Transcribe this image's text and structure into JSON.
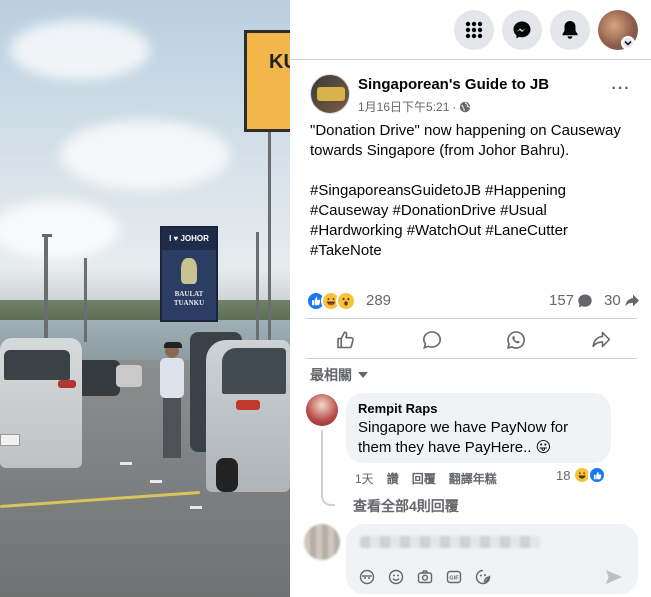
{
  "header": {
    "page_name": "Singaporean's Guide to JB",
    "timestamp": "1月16日下午5:21",
    "separator": "·",
    "more_label": "···"
  },
  "post": {
    "paragraph1": "\"Donation Drive\" now happening on Causeway towards Singapore (from Johor Bahru).",
    "paragraph2": "#SingaporeansGuidetoJB #Happening #Causeway #DonationDrive #Usual #Hardworking #WatchOut #LaneCutter #TakeNote"
  },
  "photo_signs": {
    "road_sign_text": "KU",
    "johor_sign_top": "I ♥ JOHOR",
    "johor_sign_bottom": "BAULAT TUANKU"
  },
  "stats": {
    "reaction_count": "289",
    "comment_count": "157",
    "share_count": "30"
  },
  "sort": {
    "label": "最相關"
  },
  "comment": {
    "author": "Rempit Raps",
    "text": "Singapore we have PayNow for them they have PayHere..",
    "emoji": "😛",
    "time": "1天",
    "like_label": "讚",
    "reply_label": "回覆",
    "translate_label": "翻譯年糕",
    "reaction_count": "18",
    "view_replies": "查看全部4則回覆"
  },
  "colors": {
    "accent": "#1877f2",
    "secondary_text": "#65676b",
    "bubble_bg": "#f0f2f5",
    "button_bg": "#e4e6eb"
  },
  "icons": [
    "menu-grid-icon",
    "messenger-icon",
    "notification-bell-icon",
    "globe-icon",
    "like-icon",
    "comment-icon",
    "whatsapp-icon",
    "share-icon",
    "emoji-icon",
    "camera-icon",
    "gif-icon",
    "sticker-icon",
    "send-icon"
  ]
}
